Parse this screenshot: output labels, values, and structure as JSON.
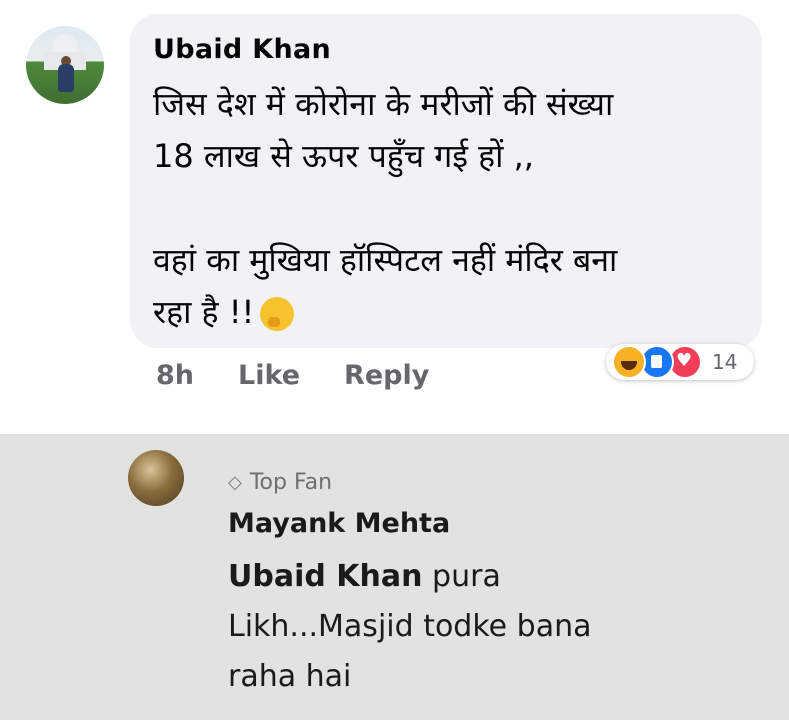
{
  "comment": {
    "author": "Ubaid Khan",
    "lines": [
      "जिस देश में कोरोना के मरीजों  की संख्या",
      "18 लाख से ऊपर पहुँच गई हों ,,",
      "वहां का मुखिया हॉस्पिटल नहीं मंदिर बना",
      "रहा है !!"
    ],
    "emoji": "thinking-face",
    "time": "8h",
    "like_label": "Like",
    "reply_label": "Reply",
    "reactions": [
      "haha",
      "like",
      "love"
    ],
    "reaction_count": "14"
  },
  "reply": {
    "badge": "Top Fan",
    "author": "Mayank Mehta",
    "mention": "Ubaid Khan",
    "text_first": "pura",
    "text_rest_1": "Likh...Masjid todke bana",
    "text_rest_2": "raha hai"
  },
  "colors": {
    "bubble": "#f0f2f5",
    "secondary_text": "#65676b",
    "like_blue": "#1877f2",
    "love_red": "#f33e58",
    "haha_yellow": "#f7b125"
  }
}
